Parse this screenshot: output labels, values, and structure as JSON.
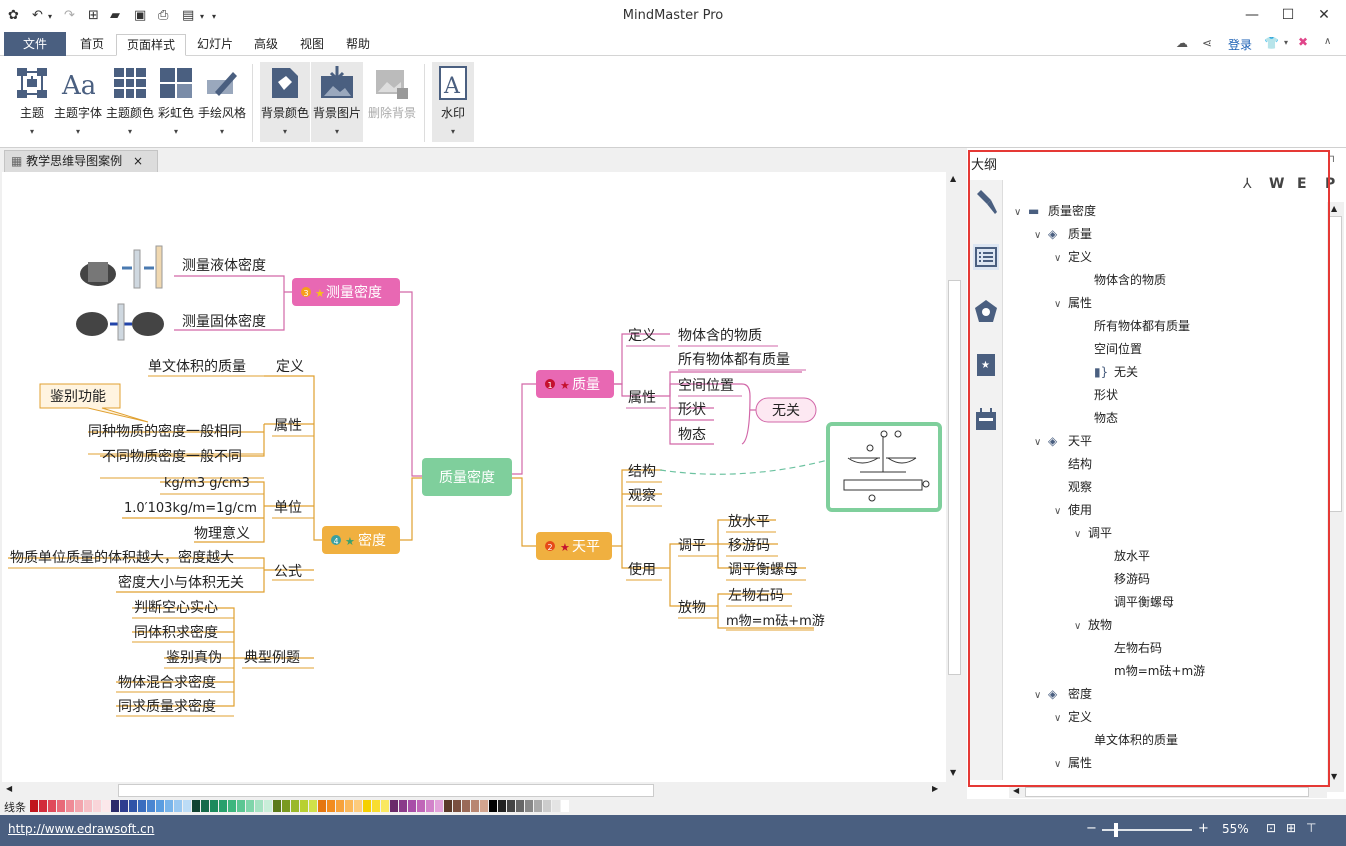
{
  "app": {
    "title": "MindMaster Pro"
  },
  "menu": {
    "file": "文件",
    "items": [
      "首页",
      "页面样式",
      "幻灯片",
      "高级",
      "视图",
      "帮助"
    ],
    "active": "页面样式",
    "login": "登录"
  },
  "ribbon": {
    "buttons": [
      {
        "label": "主题",
        "dd": true
      },
      {
        "label": "主题字体",
        "dd": true
      },
      {
        "label": "主题颜色",
        "dd": true
      },
      {
        "label": "彩虹色",
        "dd": true
      },
      {
        "label": "手绘风格",
        "dd": true
      },
      {
        "label": "背景颜色",
        "dd": true
      },
      {
        "label": "背景图片",
        "dd": true
      },
      {
        "label": "删除背景",
        "dd": false
      },
      {
        "label": "水印",
        "dd": true
      }
    ]
  },
  "doc_tab": {
    "title": "教学思维导图案例",
    "close": "×"
  },
  "map": {
    "root": "质量密度",
    "n1": {
      "label": "质量",
      "num": "1"
    },
    "n2": {
      "label": "天平",
      "num": "2"
    },
    "n3": {
      "label": "测量密度",
      "num": "3"
    },
    "n4": {
      "label": "密度",
      "num": "4"
    },
    "texts": {
      "dingyi1": "定义",
      "wuti": "物体含的物质",
      "suoyou": "所有物体都有质量",
      "shuxing1": "属性",
      "kongjian": "空间位置",
      "xingzhuang": "形状",
      "wutai": "物态",
      "wuguan": "无关",
      "jiegou": "结构",
      "guancha": "观察",
      "shiyong": "使用",
      "tiaoping": "调平",
      "fangshuiping": "放水平",
      "yiyouma": "移游码",
      "tiaoping_hm": "调平衡螺母",
      "fangwu": "放物",
      "zuowu": "左物右码",
      "mwu": "m物=m砝+m游",
      "yeti": "测量液体密度",
      "guti": "测量固体密度",
      "dingyi4": "定义",
      "danwei_tiji": "单文体积的质量",
      "jianbie_gn": "鉴别功能",
      "shuxing4": "属性",
      "tongzhong": "同种物质的密度一般相同",
      "butong": "不同物质密度一般不同",
      "danwei": "单位",
      "kgm3": "kg/m3  g/cm3",
      "conv": "1.0′103kg/m=1g/cm",
      "wuli": "物理意义",
      "gongshi": "公式",
      "gs1": "物质单位质量的体积越大，密度越大",
      "gs2": "密度大小与体积无关",
      "dianxing": "典型例题",
      "d1": "判断空心实心",
      "d2": "同体积求密度",
      "d3": "鉴别真伪",
      "d4": "物体混合求密度",
      "d5": "同求质量求密度"
    }
  },
  "panel": {
    "title": "大纲",
    "export_icons": [
      "W",
      "E",
      "P"
    ]
  },
  "outline": [
    {
      "depth": 0,
      "tw": "∨",
      "icon": "folder",
      "text": "质量密度"
    },
    {
      "depth": 1,
      "tw": "∨",
      "icon": "layers",
      "text": "质量"
    },
    {
      "depth": 2,
      "tw": "∨",
      "icon": "",
      "text": "定义"
    },
    {
      "depth": 3,
      "tw": "",
      "icon": "",
      "text": "物体含的物质"
    },
    {
      "depth": 2,
      "tw": "∨",
      "icon": "",
      "text": "属性"
    },
    {
      "depth": 3,
      "tw": "",
      "icon": "",
      "text": "所有物体都有质量"
    },
    {
      "depth": 3,
      "tw": "",
      "icon": "",
      "text": "空间位置"
    },
    {
      "depth": 3,
      "tw": "",
      "icon": "brace",
      "text": "无关"
    },
    {
      "depth": 3,
      "tw": "",
      "icon": "",
      "text": "形状"
    },
    {
      "depth": 3,
      "tw": "",
      "icon": "",
      "text": "物态"
    },
    {
      "depth": 1,
      "tw": "∨",
      "icon": "layers",
      "text": "天平"
    },
    {
      "depth": 2,
      "tw": "",
      "icon": "",
      "text": "结构"
    },
    {
      "depth": 2,
      "tw": "",
      "icon": "",
      "text": "观察"
    },
    {
      "depth": 2,
      "tw": "∨",
      "icon": "",
      "text": "使用"
    },
    {
      "depth": 3,
      "tw": "∨",
      "icon": "",
      "text": "调平"
    },
    {
      "depth": 4,
      "tw": "",
      "icon": "",
      "text": "放水平"
    },
    {
      "depth": 4,
      "tw": "",
      "icon": "",
      "text": "移游码"
    },
    {
      "depth": 4,
      "tw": "",
      "icon": "",
      "text": "调平衡螺母"
    },
    {
      "depth": 3,
      "tw": "∨",
      "icon": "",
      "text": "放物"
    },
    {
      "depth": 4,
      "tw": "",
      "icon": "",
      "text": "左物右码"
    },
    {
      "depth": 4,
      "tw": "",
      "icon": "",
      "text": "m物=m砝+m游"
    },
    {
      "depth": 1,
      "tw": "∨",
      "icon": "layers",
      "text": "密度"
    },
    {
      "depth": 2,
      "tw": "∨",
      "icon": "",
      "text": "定义"
    },
    {
      "depth": 3,
      "tw": "",
      "icon": "",
      "text": "单文体积的质量"
    },
    {
      "depth": 2,
      "tw": "∨",
      "icon": "",
      "text": "属性"
    },
    {
      "depth": 3,
      "tw": "∨",
      "icon": "",
      "text": "同种物质的密度一般相同"
    }
  ],
  "colorbar": {
    "label": "线条",
    "colors": [
      "#c0151c",
      "#d22b3b",
      "#e04a5a",
      "#e86a78",
      "#ef8b96",
      "#f3a5ad",
      "#f6bfc5",
      "#f9d5d9",
      "#fce8ea",
      "#2a2a6a",
      "#2e3d8f",
      "#3054a8",
      "#3a6dbf",
      "#4a86d1",
      "#5a9de0",
      "#78b4ea",
      "#99c8f1",
      "#bcdcf6",
      "#114433",
      "#166a4a",
      "#1b8a5d",
      "#27a06c",
      "#3db67e",
      "#5bc693",
      "#7fd5aa",
      "#a5e2c2",
      "#c9eed9",
      "#5a7a1a",
      "#7a9a20",
      "#9ab82a",
      "#b8d030",
      "#d0e04a",
      "#e5760f",
      "#f28c1e",
      "#f7a23a",
      "#fbb85a",
      "#fdcb7c",
      "#f5d000",
      "#f8dd30",
      "#fae860",
      "#6a2a6a",
      "#8a3a8a",
      "#a84ea8",
      "#c066b8",
      "#d283ca",
      "#e2a2da",
      "#5a3a2a",
      "#7a5040",
      "#9a6a58",
      "#b88672",
      "#d2a48e",
      "#000000",
      "#222222",
      "#444444",
      "#666666",
      "#888888",
      "#aaaaaa",
      "#cccccc",
      "#e4e4e4",
      "#ffffff"
    ]
  },
  "status": {
    "url": "http://www.edrawsoft.cn",
    "zoom": "55%"
  }
}
